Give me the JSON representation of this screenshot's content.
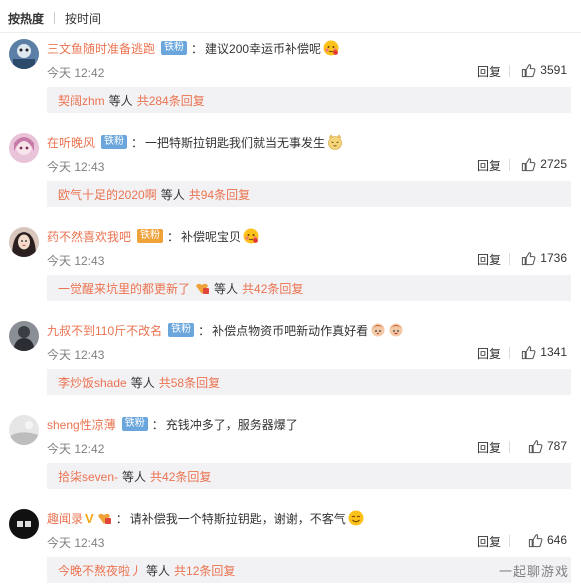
{
  "sort": {
    "hot": "按热度",
    "time": "按时间"
  },
  "comments": [
    {
      "user": "三文鱼随时准备逃跑",
      "badge": "铁粉",
      "text": "建议200幸运币补偿呢",
      "emoji": "blush-face",
      "time": "今天 12:42",
      "reply": "回复",
      "likes": "3591",
      "sub_user": "契阔zhm",
      "sub_mid": "等人",
      "sub_count": "共284条回复"
    },
    {
      "user": "在听晚风",
      "badge": "铁粉",
      "text": "一把特斯拉钥匙我们就当无事发生",
      "emoji": "cat-face",
      "time": "今天 12:43",
      "reply": "回复",
      "likes": "2725",
      "sub_user": "欧气十足的2020啊",
      "sub_mid": "等人",
      "sub_count": "共94条回复"
    },
    {
      "user": "药不然喜欢我吧",
      "badge": "铁粉",
      "text": "补偿呢宝贝",
      "emoji": "blush-face",
      "time": "今天 12:43",
      "reply": "回复",
      "likes": "1736",
      "sub_user": "一觉醒来坑里的都更新了",
      "sub_mid": "等人",
      "sub_count": "共42条回复"
    },
    {
      "user": "九叔不到110斤不改名",
      "badge": "铁粉",
      "text": "补偿点物资币吧新动作真好看",
      "emoji": "doll-face",
      "time": "今天 12:43",
      "reply": "回复",
      "likes": "1341",
      "sub_user": "李炒饭shade",
      "sub_mid": "等人",
      "sub_count": "共58条回复"
    },
    {
      "user": "sheng性凉薄",
      "badge": "铁粉",
      "text": "充钱冲多了，服务器爆了",
      "emoji": "",
      "time": "今天 12:42",
      "reply": "回复",
      "likes": "787",
      "sub_user": "拾柒seven-",
      "sub_mid": "等人",
      "sub_count": "共42条回复"
    },
    {
      "user": "趣闻录",
      "badge": "",
      "text": "请补偿我一个特斯拉钥匙，谢谢，不客气",
      "emoji": "smile-face",
      "time": "今天 12:43",
      "reply": "回复",
      "likes": "646",
      "sub_user": "今晚不熬夜啦丿",
      "sub_mid": "等人",
      "sub_count": "共12条回复"
    }
  ],
  "watermark": "一起聊游戏",
  "colors": {
    "username": "#eb7350",
    "fan_badge": "#6aa6dc",
    "sub_bg": "#f2f2f5",
    "time": "#808080"
  }
}
